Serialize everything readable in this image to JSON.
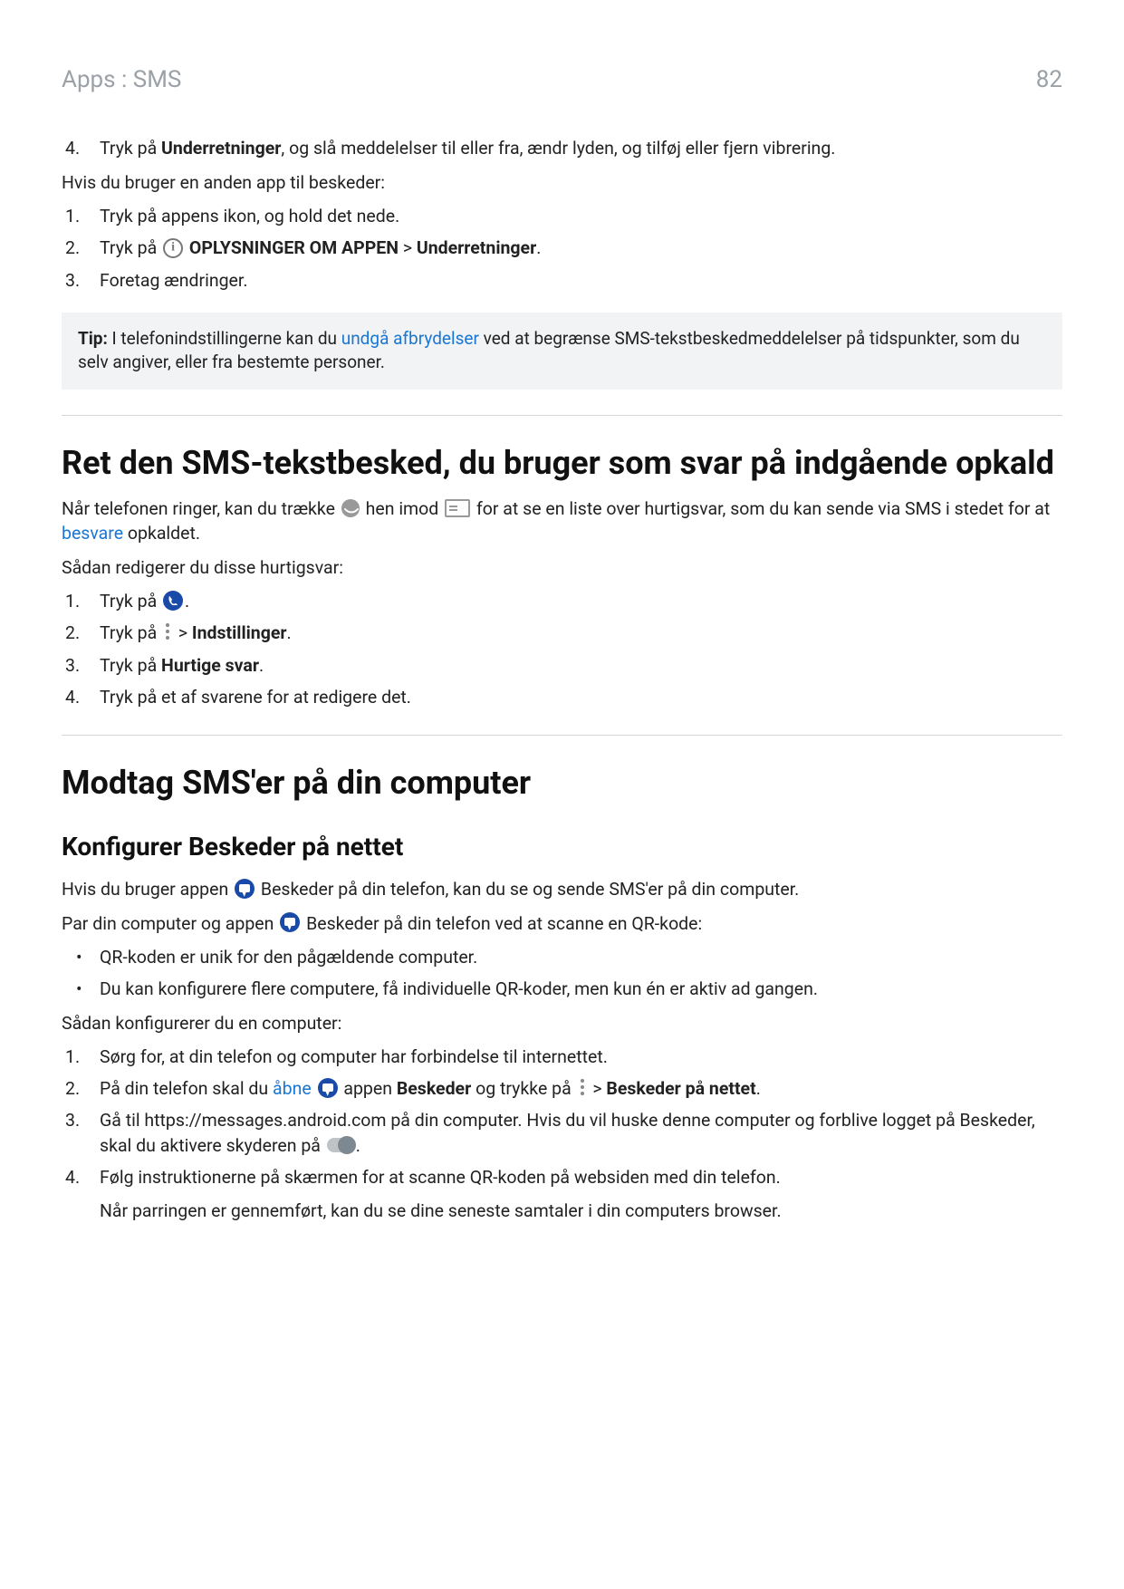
{
  "header": {
    "breadcrumb": "Apps : SMS",
    "page": "82"
  },
  "topList": {
    "item4_a": "Tryk på ",
    "item4_b": "Underretninger",
    "item4_c": ", og slå meddelelser til eller fra, ændr lyden, og tilføj eller fjern vibrering."
  },
  "otherApp": {
    "intro": "Hvis du bruger en anden app til beskeder:",
    "i1": "Tryk på appens ikon, og hold det nede.",
    "i2a": "Tryk på ",
    "i2b": "OPLYSNINGER OM APPEN",
    "i2gt": " > ",
    "i2c": "Underretninger",
    "i2d": ".",
    "i3": "Foretag ændringer."
  },
  "tip": {
    "label": "Tip:",
    "a": " I telefonindstillingerne kan du ",
    "link": "undgå afbrydelser",
    "b": " ved at begrænse SMS-tekstbeskedmeddelelser på tidspunkter, som du selv angiver, eller fra bestemte personer."
  },
  "sec1": {
    "title": "Ret den SMS-tekstbesked, du bruger som svar på indgående opkald",
    "p1a": "Når telefonen ringer, kan du trække ",
    "p1b": " hen imod ",
    "p1c": " for at se en liste over hurtigsvar, som du kan sende via SMS i stedet for at ",
    "p1link": "besvare",
    "p1d": " opkaldet.",
    "p2": "Sådan redigerer du disse hurtigsvar:",
    "l1a": "Tryk på ",
    "l1b": ".",
    "l2a": "Tryk på ",
    "l2gt": " > ",
    "l2b": "Indstillinger",
    "l2c": ".",
    "l3a": "Tryk på ",
    "l3b": "Hurtige svar",
    "l3c": ".",
    "l4": "Tryk på et af svarene for at redigere det."
  },
  "sec2": {
    "title": "Modtag SMS'er på din computer",
    "h2": "Konfigurer Beskeder på nettet",
    "p1a": "Hvis du bruger appen ",
    "p1b": " Beskeder på din telefon, kan du se og sende SMS'er på din computer.",
    "p2a": "Par din computer og appen ",
    "p2b": " Beskeder på din telefon ved at scanne en QR-kode:",
    "b1": "QR-koden er unik for den pågældende computer.",
    "b2": "Du kan konfigurere flere computere, få individuelle QR-koder, men kun én er aktiv ad gangen.",
    "p3": "Sådan konfigurerer du en computer:",
    "o1": "Sørg for, at din telefon og computer har forbindelse til internettet.",
    "o2a": "På din telefon skal du ",
    "o2link": "åbne",
    "o2b": " appen ",
    "o2c": "Beskeder",
    "o2d": " og trykke på ",
    "o2gt": " > ",
    "o2e": "Beskeder på nettet",
    "o2f": ".",
    "o3a": "Gå til https://messages.android.com på din computer. Hvis du vil huske denne computer og forblive logget på Beskeder, skal du aktivere skyderen på ",
    "o3b": ".",
    "o4": "Følg instruktionerne på skærmen for at scanne QR-koden på websiden med din telefon.",
    "o4p": "Når parringen er gennemført, kan du se dine seneste samtaler i din computers browser."
  }
}
